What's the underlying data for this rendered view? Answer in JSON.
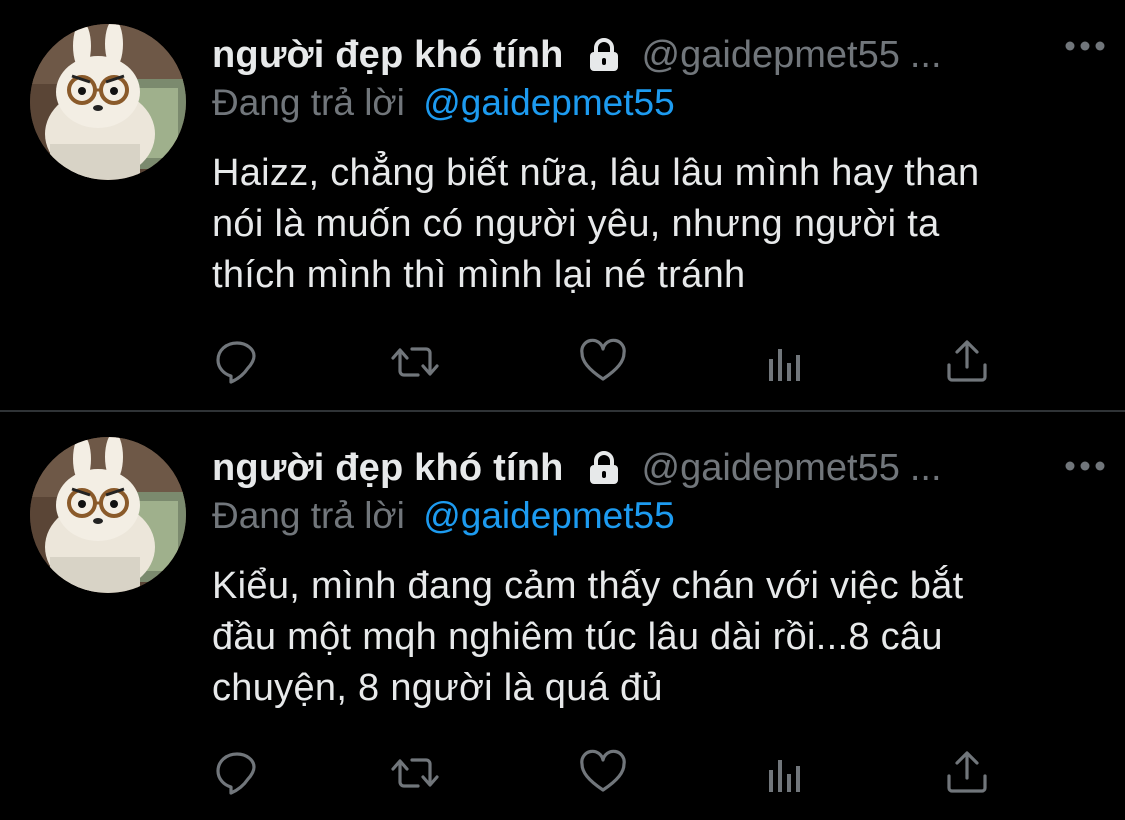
{
  "tweets": [
    {
      "display_name": "người đẹp khó tính",
      "handle": "@gaidepmet55",
      "ellipsis": "...",
      "reply_label": "Đang trả lời",
      "reply_handle": "@gaidepmet55",
      "lines": [
        "Haizz, chẳng biết nữa, lâu lâu mình hay than",
        "nói là muốn có người yêu, nhưng người ta",
        "thích mình thì mình lại né tránh"
      ],
      "icons": [
        "lock-icon",
        "more-icon",
        "reply-icon",
        "retweet-icon",
        "like-icon",
        "views-icon",
        "share-icon"
      ]
    },
    {
      "display_name": "người đẹp khó tính",
      "handle": "@gaidepmet55",
      "ellipsis": "...",
      "reply_label": "Đang trả lời",
      "reply_handle": "@gaidepmet55",
      "lines": [
        "Kiểu, mình đang cảm thấy chán với việc bắt",
        "đầu một mqh nghiêm túc lâu dài rồi...8 câu",
        "chuyện, 8 người là quá đủ"
      ],
      "icons": [
        "lock-icon",
        "more-icon",
        "reply-icon",
        "retweet-icon",
        "like-icon",
        "views-icon",
        "share-icon"
      ]
    }
  ],
  "colors": {
    "background": "#000000",
    "text": "#e7e9ea",
    "secondary": "#71767b",
    "link": "#1d9bf0",
    "divider": "#2f3336"
  }
}
